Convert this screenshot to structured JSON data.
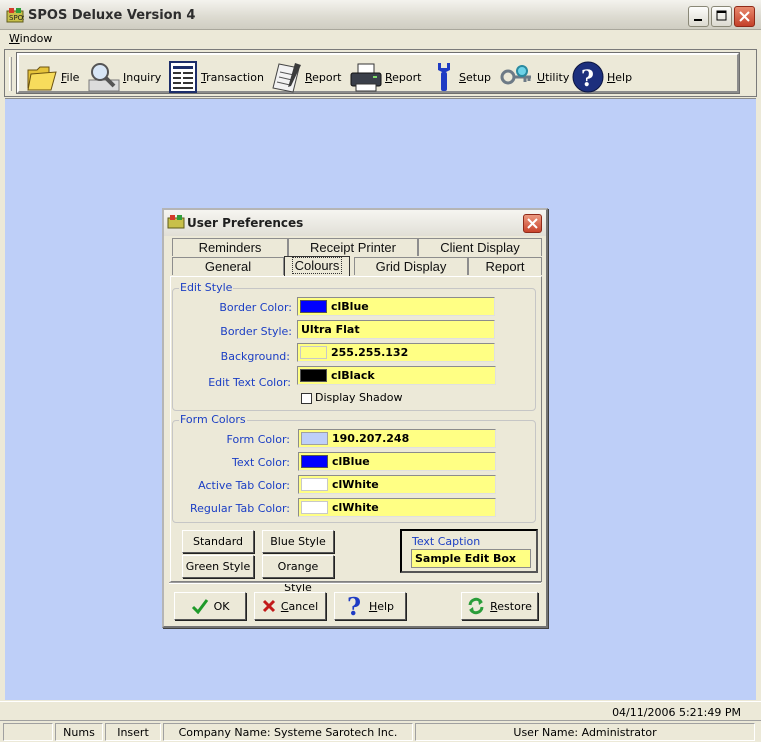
{
  "window": {
    "title": "SPOS Deluxe Version 4"
  },
  "menu": {
    "items": [
      "Window"
    ]
  },
  "toolbar": {
    "buttons": [
      {
        "label": "File",
        "icon": "folder-icon"
      },
      {
        "label": "Inquiry",
        "icon": "magnifier-icon"
      },
      {
        "label": "Transaction",
        "icon": "form-icon"
      },
      {
        "label": "Report",
        "icon": "notepad-icon"
      },
      {
        "label": "Report",
        "icon": "printer-icon"
      },
      {
        "label": "Setup",
        "icon": "wrench-icon"
      },
      {
        "label": "Utility",
        "icon": "key-icon"
      },
      {
        "label": "Help",
        "icon": "help-icon"
      }
    ]
  },
  "dialog": {
    "title": "User Preferences",
    "tabs_back": [
      "Reminders",
      "Receipt Printer",
      "Client Display"
    ],
    "tabs_front": [
      "General",
      "Colours",
      "Grid Display",
      "Report"
    ],
    "active_tab": "Colours",
    "edit_style": {
      "legend": "Edit Style",
      "fields": [
        {
          "label": "Border Color:",
          "value": "clBlue",
          "swatch": "#0000FF"
        },
        {
          "label": "Border Style:",
          "value": "Ultra Flat"
        },
        {
          "label": "Background:",
          "value": "255.255.132",
          "swatch": "#FFFF84"
        },
        {
          "label": "Edit Text Color:",
          "value": "clBlack",
          "swatch": "#000000"
        }
      ],
      "checkbox_label": "Display Shadow",
      "checkbox_checked": false
    },
    "form_colors": {
      "legend": "Form Colors",
      "fields": [
        {
          "label": "Form Color:",
          "value": "190.207.248",
          "swatch": "#BECFF8"
        },
        {
          "label": "Text Color:",
          "value": "clBlue",
          "swatch": "#0000FF"
        },
        {
          "label": "Active Tab Color:",
          "value": "clWhite",
          "swatch": "#FFFFFF"
        },
        {
          "label": "Regular Tab Color:",
          "value": "clWhite",
          "swatch": "#FFFFFF"
        }
      ]
    },
    "style_buttons": [
      "Standard",
      "Blue Style",
      "Green Style",
      "Orange Style"
    ],
    "text_caption": {
      "label": "Text Caption",
      "value": "Sample Edit Box"
    },
    "actions": {
      "ok": "OK",
      "cancel": "Cancel",
      "help": "Help",
      "restore": "Restore"
    }
  },
  "status": {
    "datetime": "04/11/2006  5:21:49 PM",
    "nums": "Nums",
    "insert": "Insert",
    "company": "Company Name: Systeme Sarotech Inc.",
    "user": "User Name: Administrator"
  },
  "colors": {
    "workspace": "#BECFF8",
    "field_bg": "#FFFF84",
    "label_blue": "#1B3EC4"
  }
}
